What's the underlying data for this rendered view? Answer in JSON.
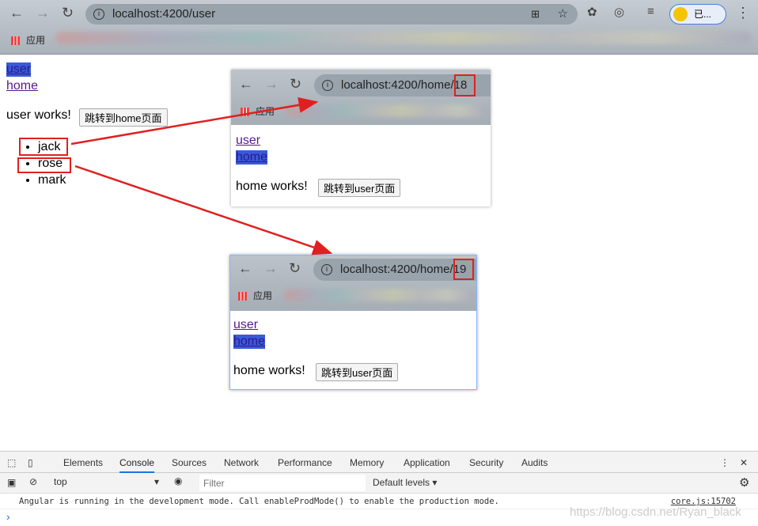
{
  "browser": {
    "url": "localhost:4200/user",
    "bookmarks_label": "应用",
    "profile_label": "已..."
  },
  "page": {
    "links": [
      "user",
      "home"
    ],
    "heading": "user works!",
    "button": "跳转到home页面",
    "users": [
      "jack",
      "rose",
      "mark"
    ]
  },
  "insets": [
    {
      "url_base": "localhost:4200/home",
      "url_id": "/18",
      "bookmarks_label": "应用",
      "links": [
        "user",
        "home"
      ],
      "heading": "home works!",
      "button": "跳转到user页面"
    },
    {
      "url_base": "localhost:4200/home",
      "url_id": "/19",
      "bookmarks_label": "应用",
      "links": [
        "user",
        "home"
      ],
      "heading": "home works!",
      "button": "跳转到user页面"
    }
  ],
  "annotation_color": "#e02020",
  "devtools": {
    "tabs": [
      "Elements",
      "Console",
      "Sources",
      "Network",
      "Performance",
      "Memory",
      "Application",
      "Security",
      "Audits"
    ],
    "active_tab": "Console",
    "context": "top",
    "filter_placeholder": "Filter",
    "levels": "Default levels ▾",
    "message": "Angular is running in the development mode. Call enableProdMode() to enable the production mode.",
    "source": "core.js:15702",
    "prompt": "›"
  },
  "watermark": "https://blog.csdn.net/Ryan_black"
}
